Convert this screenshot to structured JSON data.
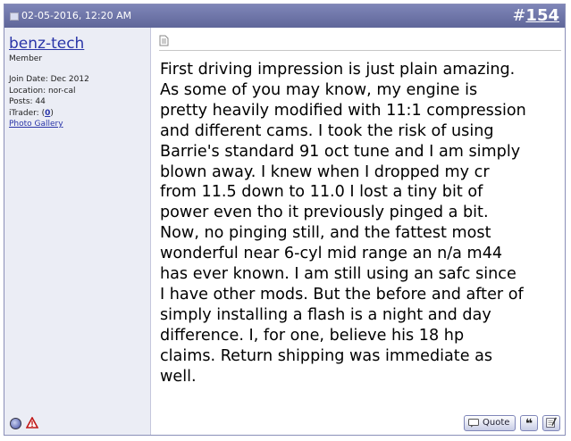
{
  "header": {
    "date": "02-05-2016, 12:20 AM",
    "post_number_prefix": "#",
    "post_number": "154"
  },
  "user": {
    "name": "benz-tech",
    "title": "Member",
    "join_date": "Join Date: Dec 2012",
    "location": "Location: nor-cal",
    "posts": "Posts: 44",
    "itrader_prefix": "iTrader: (",
    "itrader_value": "0",
    "itrader_suffix": ")",
    "photo_gallery": "Photo Gallery"
  },
  "message": {
    "lines": [
      "First driving impression is just plain amazing.",
      "As some of you may know, my engine is",
      "pretty heavily modified with 11:1 compression",
      "and different cams. I took the risk of using",
      "Barrie's standard 91 oct tune and I am simply",
      "blown away. I knew when I dropped my cr",
      "from 11.5 down to 11.0 I lost a tiny bit of",
      "power even tho it previously pinged a bit.",
      "Now, no pinging still, and the fattest most",
      "wonderful near 6-cyl mid range an n/a m44",
      "has ever known. I am still using an safc since",
      "I have other mods. But the before and after of",
      "simply installing a flash is a night and day",
      "difference. I, for one, believe his 18 hp",
      "claims. Return shipping was immediate as",
      "well."
    ]
  },
  "actions": {
    "quote_label": "Quote"
  },
  "colors": {
    "header_bg": "#6f76a9",
    "sidebar_bg": "#ebedf5",
    "link": "#2a35a8"
  }
}
